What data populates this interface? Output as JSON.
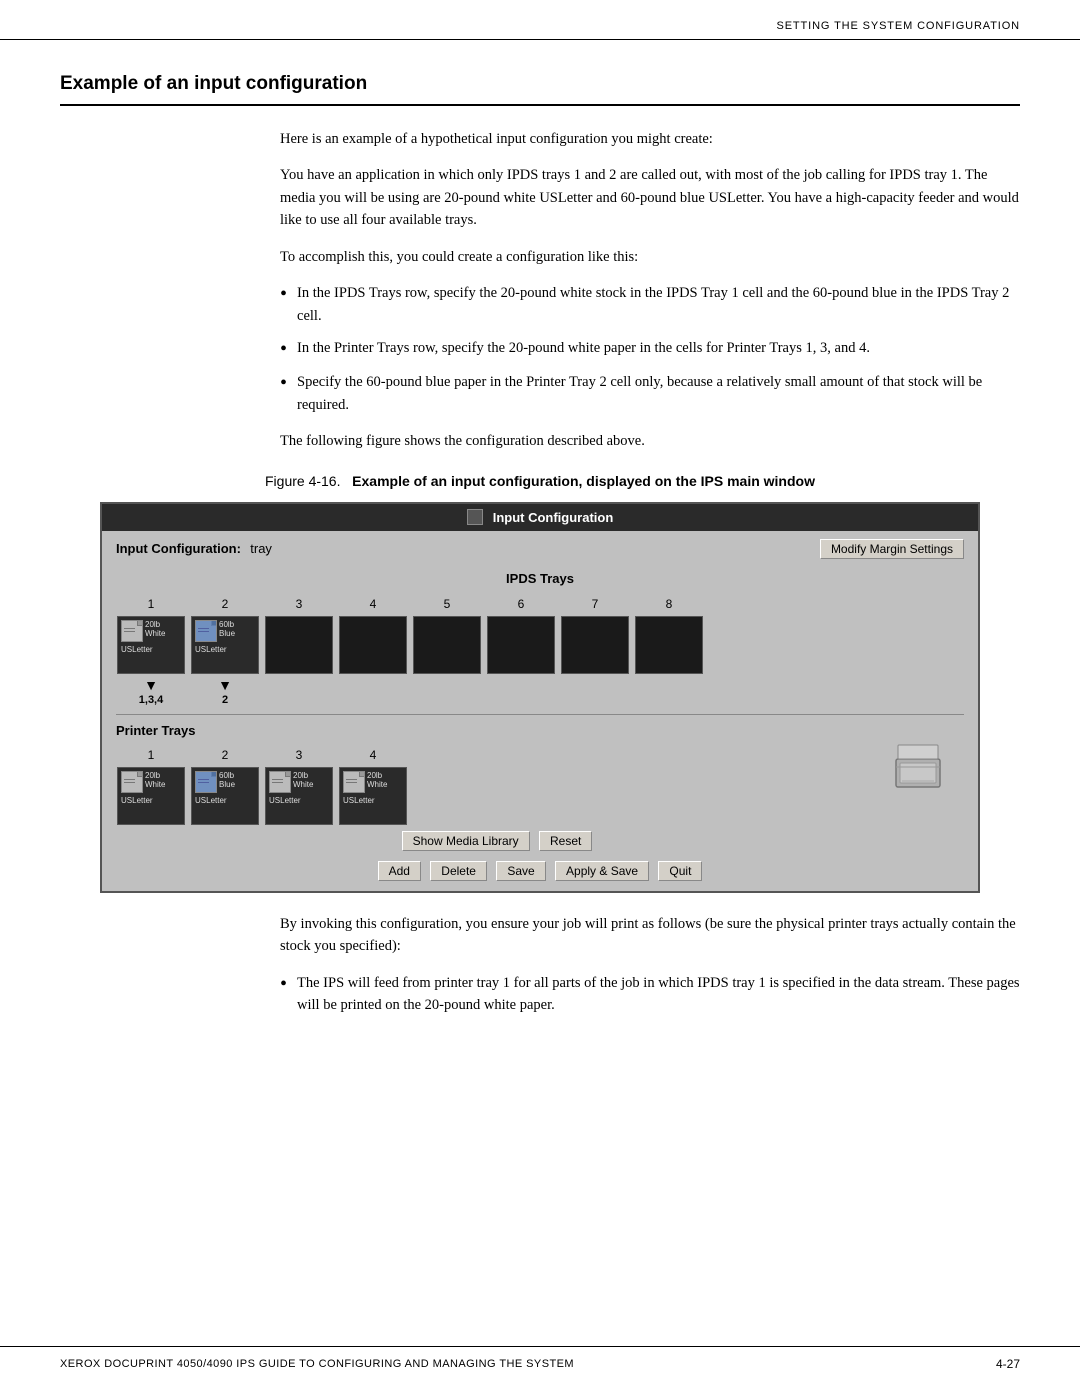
{
  "header": {
    "text": "Setting the System Configuration"
  },
  "section": {
    "title": "Example of an input configuration"
  },
  "body": {
    "para1": "Here is an example of a hypothetical input configuration you might create:",
    "para2": "You have an application in which only IPDS trays 1 and 2 are called out, with most of the job calling for IPDS tray 1. The media you will be using are 20-pound white USLetter and 60-pound blue USLetter. You have a high-capacity feeder and would like to use all four available trays.",
    "para3": "To accomplish this, you could create a configuration like this:",
    "bullets": [
      "In the IPDS Trays row, specify the 20-pound white stock in the IPDS Tray 1 cell and the 60-pound blue in the IPDS Tray 2 cell.",
      "In the Printer Trays row, specify the 20-pound white paper in the cells for Printer Trays 1, 3, and 4.",
      "Specify the 60-pound blue paper in the Printer Tray 2 cell only, because a relatively small amount of that stock will be required."
    ],
    "para4": "The following figure shows the configuration described above."
  },
  "figure": {
    "number": "Figure 4-16.",
    "title": "Example of an input configuration, displayed on the IPS main window"
  },
  "dialog": {
    "title": "Input Configuration",
    "input_config_label": "Input Configuration:",
    "input_config_value": "tray",
    "modify_margin_btn": "Modify Margin Settings",
    "ipds_trays_label": "IPDS Trays",
    "ipds_cols": [
      "1",
      "2",
      "3",
      "4",
      "5",
      "6",
      "7",
      "8"
    ],
    "ipds_filled": [
      {
        "weight": "20lb",
        "color": "White",
        "media": "USLetter"
      },
      {
        "weight": "60lb",
        "color": "Blue",
        "media": "USLetter"
      },
      null,
      null,
      null,
      null,
      null,
      null
    ],
    "arrow_cols": [
      {
        "label": "1,3,4",
        "show": true
      },
      {
        "label": "2",
        "show": true
      },
      {
        "label": "",
        "show": false
      },
      {
        "label": "",
        "show": false
      },
      {
        "label": "",
        "show": false
      },
      {
        "label": "",
        "show": false
      },
      {
        "label": "",
        "show": false
      },
      {
        "label": "",
        "show": false
      }
    ],
    "printer_trays_label": "Printer Trays",
    "printer_cols": [
      "1",
      "2",
      "3",
      "4"
    ],
    "printer_filled": [
      {
        "weight": "20lb",
        "color": "White",
        "media": "USLetter"
      },
      {
        "weight": "60lb",
        "color": "Blue",
        "media": "USLetter"
      },
      {
        "weight": "20lb",
        "color": "White",
        "media": "USLetter"
      },
      {
        "weight": "20lb",
        "color": "White",
        "media": "USLetter"
      }
    ],
    "show_media_btn": "Show Media Library",
    "reset_btn": "Reset",
    "add_btn": "Add",
    "delete_btn": "Delete",
    "save_btn": "Save",
    "apply_save_btn": "Apply & Save",
    "quit_btn": "Quit"
  },
  "lower_body": {
    "para1": "By invoking this configuration, you ensure your job will print as follows (be sure the physical printer trays actually contain the stock you specified):",
    "bullets": [
      "The IPS will feed from printer tray 1 for all parts of the job in which IPDS tray 1 is specified in the data stream. These pages will be printed on the 20-pound white paper."
    ]
  },
  "footer": {
    "left": "Xerox DocuPrint 4050/4090 IPS Guide to Configuring and Managing the System",
    "right": "4-27"
  }
}
